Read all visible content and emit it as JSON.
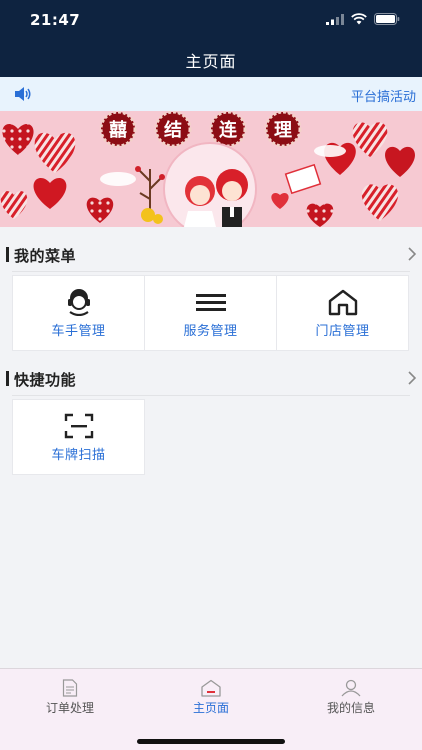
{
  "status_bar": {
    "time": "21:47"
  },
  "header": {
    "title": "主页面"
  },
  "notice": {
    "text": "平台搞活动"
  },
  "banner": {
    "characters": [
      "囍",
      "结",
      "连",
      "理"
    ]
  },
  "menu_section": {
    "title": "我的菜单",
    "items": [
      {
        "label": "车手管理",
        "icon": "headset-person-icon"
      },
      {
        "label": "服务管理",
        "icon": "menu-lines-icon"
      },
      {
        "label": "门店管理",
        "icon": "store-house-icon"
      }
    ]
  },
  "quick_section": {
    "title": "快捷功能",
    "items": [
      {
        "label": "车牌扫描",
        "icon": "scan-icon"
      }
    ]
  },
  "tabbar": {
    "tabs": [
      {
        "label": "订单处理",
        "icon": "document-icon",
        "active": false
      },
      {
        "label": "主页面",
        "icon": "home-icon",
        "active": true
      },
      {
        "label": "我的信息",
        "icon": "user-icon",
        "active": false
      }
    ]
  },
  "colors": {
    "header": "#0e2340",
    "accent": "#2a6fd6",
    "tabbar": "#f8eef7",
    "notice": "#e8f3fd"
  }
}
